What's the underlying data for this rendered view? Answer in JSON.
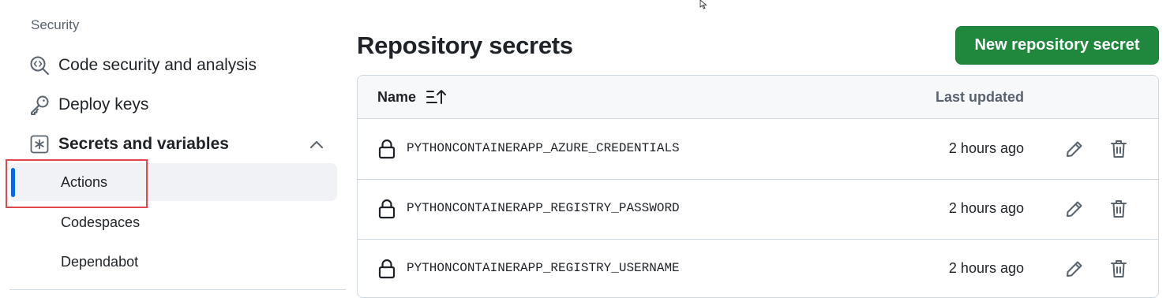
{
  "sidebar": {
    "section_heading": "Security",
    "items": [
      {
        "label": "Code security and analysis",
        "icon": "codescan-icon"
      },
      {
        "label": "Deploy keys",
        "icon": "key-icon"
      },
      {
        "label": "Secrets and variables",
        "icon": "asterisk-icon",
        "expanded": true
      }
    ],
    "sub_items": [
      {
        "label": "Actions",
        "active": true
      },
      {
        "label": "Codespaces",
        "active": false
      },
      {
        "label": "Dependabot",
        "active": false
      }
    ]
  },
  "main": {
    "title": "Repository secrets",
    "new_button_label": "New repository secret",
    "table": {
      "columns": {
        "name": "Name",
        "last_updated": "Last updated"
      },
      "rows": [
        {
          "name": "PYTHONCONTAINERAPP_AZURE_CREDENTIALS",
          "updated": "2 hours ago"
        },
        {
          "name": "PYTHONCONTAINERAPP_REGISTRY_PASSWORD",
          "updated": "2 hours ago"
        },
        {
          "name": "PYTHONCONTAINERAPP_REGISTRY_USERNAME",
          "updated": "2 hours ago"
        }
      ]
    }
  },
  "colors": {
    "primary_button": "#1f883d",
    "active_indicator": "#0969da",
    "annotation_box": "#e0474c"
  }
}
